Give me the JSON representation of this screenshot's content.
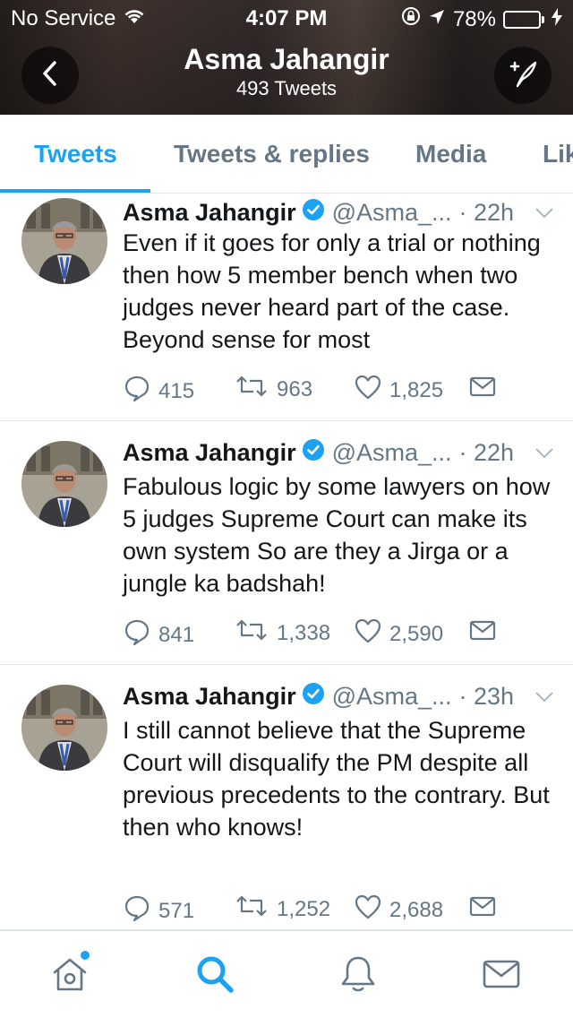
{
  "status": {
    "carrier": "No Service",
    "time": "4:07 PM",
    "battery": "78%",
    "battery_level": 0.78
  },
  "header": {
    "title": "Asma Jahangir",
    "subtitle": "493 Tweets"
  },
  "tabs": [
    {
      "label": "Tweets",
      "active": true
    },
    {
      "label": "Tweets & replies",
      "active": false
    },
    {
      "label": "Media",
      "active": false
    },
    {
      "label": "Lik",
      "active": false
    }
  ],
  "tweets": [
    {
      "name": "Asma Jahangir",
      "handle": "@Asma_...",
      "time": "· 22h",
      "text": "Even if it goes for only a trial or nothing then how 5 member bench when two judges never heard part of the case. Beyond sense for most",
      "replies": "415",
      "retweets": "963",
      "likes": "1,825"
    },
    {
      "name": "Asma Jahangir",
      "handle": "@Asma_...",
      "time": "· 22h",
      "text": "Fabulous logic by some lawyers on how 5 judges Supreme Court can make its own system So are they a Jirga or a jungle ka badshah!",
      "replies": "841",
      "retweets": "1,338",
      "likes": "2,590"
    },
    {
      "name": "Asma Jahangir",
      "handle": "@Asma_...",
      "time": "· 23h",
      "text": "I still cannot believe that the Supreme Court will disqualify the PM  despite all previous precedents to the contrary. But then who knows!",
      "replies": "571",
      "retweets": "1,252",
      "likes": "2,688"
    }
  ],
  "colors": {
    "accent": "#1da1f2",
    "secondary_text": "#657786",
    "battery": "#4cd964"
  },
  "icons": {
    "nav": [
      "home-icon",
      "search-icon",
      "notifications-icon",
      "messages-icon"
    ]
  }
}
